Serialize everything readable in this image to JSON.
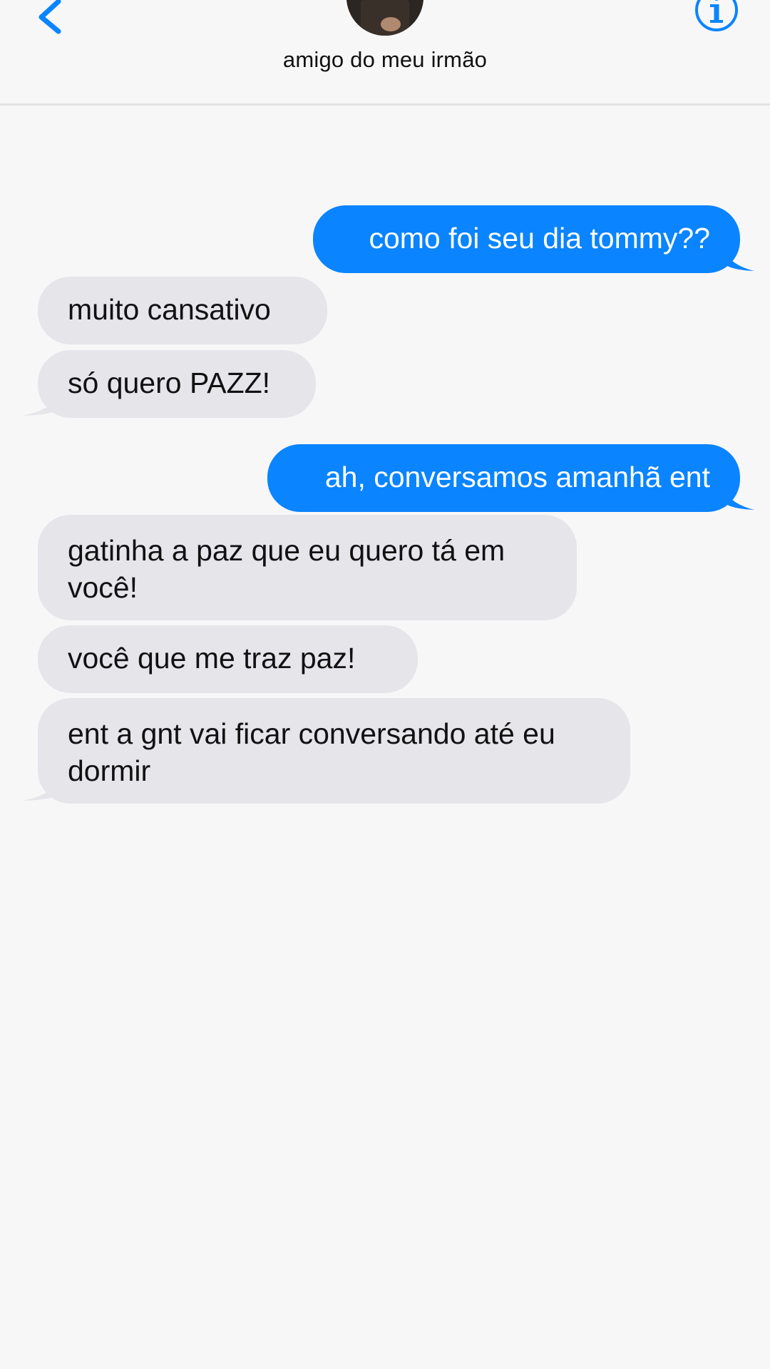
{
  "header": {
    "contact_name": "amigo do meu irmão",
    "back_icon": "chevron-left-icon",
    "info_icon": "info-circle-icon",
    "accent_color": "#0a84ff"
  },
  "messages": [
    {
      "direction": "sent",
      "text": "como foi seu dia tommy??"
    },
    {
      "direction": "received",
      "text": "muito cansativo"
    },
    {
      "direction": "received",
      "text": "só quero PAZZ!"
    },
    {
      "direction": "sent",
      "text": "ah, conversamos amanhã ent"
    },
    {
      "direction": "received",
      "text": "gatinha a paz que eu quero tá em você!"
    },
    {
      "direction": "received",
      "text": "você que me traz paz!"
    },
    {
      "direction": "received",
      "text": "ent a gnt vai ficar conversando até eu dormir"
    }
  ],
  "colors": {
    "sent_bubble": "#0a84ff",
    "received_bubble": "#e5e5ea",
    "background": "#f7f7f8"
  }
}
